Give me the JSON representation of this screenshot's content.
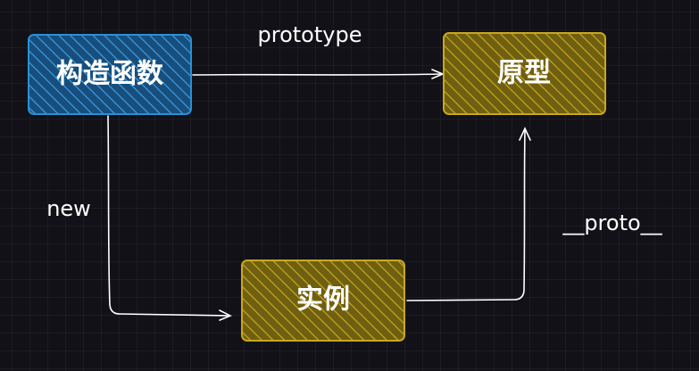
{
  "nodes": {
    "constructor": {
      "label": "构造函数",
      "fill": "#1f6aa5",
      "stroke": "#2b8fd6"
    },
    "prototype": {
      "label": "原型",
      "fill": "#9a8315",
      "stroke": "#c9a81e"
    },
    "instance": {
      "label": "实例",
      "fill": "#9a8315",
      "stroke": "#c9a81e"
    }
  },
  "edges": {
    "constructor_to_prototype": {
      "label": "prototype"
    },
    "constructor_to_instance": {
      "label": "new"
    },
    "instance_to_prototype": {
      "label": "__proto__"
    }
  },
  "colors": {
    "background": "#121117",
    "line": "#ffffff"
  }
}
